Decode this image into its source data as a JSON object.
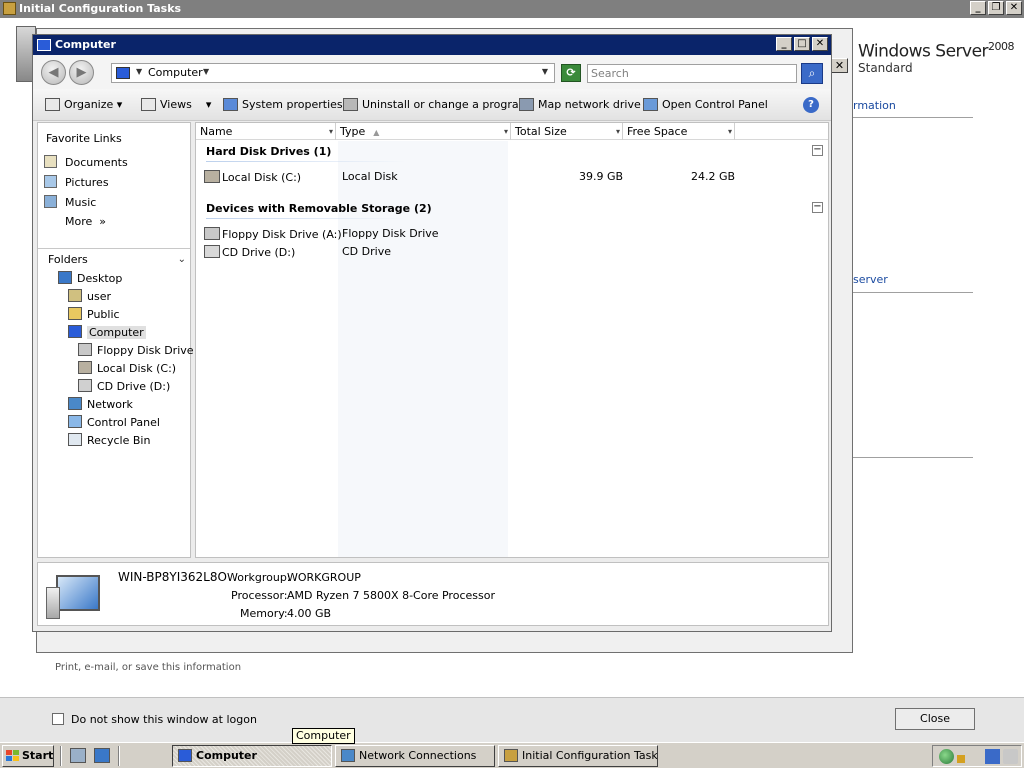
{
  "background_window": {
    "title": "Initial Configuration Tasks",
    "brand": {
      "name": "Windows Server",
      "version": "2008",
      "edition": "Standard"
    },
    "links": [
      "rmation",
      "server"
    ],
    "small_text": "Print, e-mail, or save this information",
    "dont_show_label": "Do not show this window at logon",
    "close_label": "Close"
  },
  "explorer": {
    "title": "Computer",
    "address": "Computer",
    "search_placeholder": "Search",
    "toolbar": {
      "organize": "Organize",
      "views": "Views",
      "system_properties": "System properties",
      "uninstall": "Uninstall or change a program",
      "map_drive": "Map network drive",
      "control_panel": "Open Control Panel"
    },
    "favorites": {
      "heading": "Favorite Links",
      "items": [
        "Documents",
        "Pictures",
        "Music"
      ],
      "more": "More"
    },
    "folders_heading": "Folders",
    "tree": [
      "Desktop",
      "user",
      "Public",
      "Computer",
      "Floppy Disk Drive (A:)",
      "Local Disk (C:)",
      "CD Drive (D:)",
      "Network",
      "Control Panel",
      "Recycle Bin"
    ],
    "columns": [
      "Name",
      "Type",
      "Total Size",
      "Free Space"
    ],
    "groups": [
      {
        "title": "Hard Disk Drives (1)",
        "items": [
          {
            "name": "Local Disk (C:)",
            "type": "Local Disk",
            "total": "39.9 GB",
            "free": "24.2 GB"
          }
        ]
      },
      {
        "title": "Devices with Removable Storage (2)",
        "items": [
          {
            "name": "Floppy Disk Drive (A:)",
            "type": "Floppy Disk Drive",
            "total": "",
            "free": ""
          },
          {
            "name": "CD Drive (D:)",
            "type": "CD Drive",
            "total": "",
            "free": ""
          }
        ]
      }
    ],
    "details": {
      "computer_name": "WIN-BP8YI362L8O",
      "workgroup_label": "Workgroup:",
      "workgroup_value": "WORKGROUP",
      "processor_label": "Processor:",
      "processor_value": "AMD Ryzen 7 5800X 8-Core Processor",
      "memory_label": "Memory:",
      "memory_value": "4.00 GB"
    }
  },
  "tooltip": "Computer",
  "taskbar": {
    "start_label": "Start",
    "tasks": [
      "Computer",
      "Network Connections",
      "Initial Configuration Tasks"
    ]
  },
  "colors": {
    "titlebar_active": "#0a246a",
    "titlebar_inactive": "#7f7f7f",
    "link": "#1a4aa0",
    "taskbar": "#d4d0c8"
  }
}
